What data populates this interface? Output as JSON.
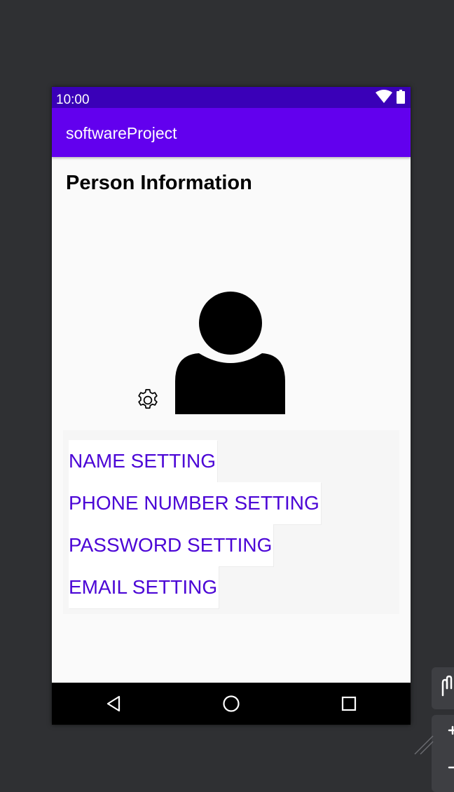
{
  "status_bar": {
    "time": "10:00",
    "icons": [
      "wifi-icon",
      "battery-icon"
    ]
  },
  "app_bar": {
    "title": "softwareProject"
  },
  "page": {
    "title": "Person Information",
    "icons": [
      "gear-icon",
      "person-avatar-icon"
    ]
  },
  "menu": {
    "items": [
      {
        "label": "NAME SETTING"
      },
      {
        "label": "PHONE NUMBER SETTING"
      },
      {
        "label": "PASSWORD SETTING"
      },
      {
        "label": "EMAIL SETTING"
      }
    ]
  },
  "nav_bar": {
    "icons": [
      "back-icon",
      "home-icon",
      "recents-icon"
    ]
  },
  "colors": {
    "status_bar": "#3a00b8",
    "app_bar": "#6200ee",
    "menu_text": "#4b05d6",
    "nav_bar": "#000000",
    "desktop": "#2f3033"
  }
}
